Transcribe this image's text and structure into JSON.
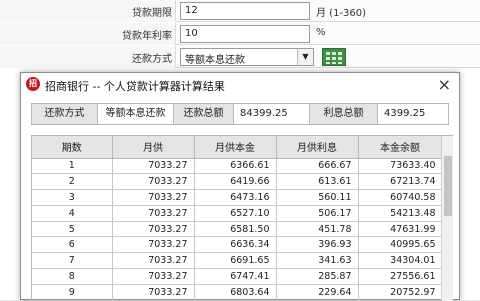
{
  "form": {
    "term_label": "贷款期限",
    "term_value": "12",
    "term_unit": "月 (1-360)",
    "rate_label": "贷款年利率",
    "rate_value": "10",
    "rate_unit": "%",
    "method_label": "还款方式",
    "method_value": "等额本息还款",
    "dropdown_icon": "chevron-down-icon",
    "calc_icon": "calculator-icon"
  },
  "dialog": {
    "title": "招商银行 -- 个人贷款计算器计算结果",
    "logo_text": "招",
    "close_glyph": "×",
    "summary": {
      "method_label": "还款方式",
      "method_value": "等额本息还款",
      "total_label": "还款总额",
      "total_value": "84399.25",
      "interest_label": "利息总额",
      "interest_value": "4399.25"
    },
    "table": {
      "headers": [
        "期数",
        "月供",
        "月供本金",
        "月供利息",
        "本金余额"
      ],
      "rows": [
        [
          "1",
          "7033.27",
          "6366.61",
          "666.67",
          "73633.40"
        ],
        [
          "2",
          "7033.27",
          "6419.66",
          "613.61",
          "67213.74"
        ],
        [
          "3",
          "7033.27",
          "6473.16",
          "560.11",
          "60740.58"
        ],
        [
          "4",
          "7033.27",
          "6527.10",
          "506.17",
          "54213.48"
        ],
        [
          "5",
          "7033.27",
          "6581.50",
          "451.78",
          "47631.99"
        ],
        [
          "6",
          "7033.27",
          "6636.34",
          "396.93",
          "40995.65"
        ],
        [
          "7",
          "7033.27",
          "6691.65",
          "341.63",
          "34304.01"
        ],
        [
          "8",
          "7033.27",
          "6747.41",
          "285.87",
          "27556.61"
        ],
        [
          "9",
          "7033.27",
          "6803.64",
          "229.64",
          "20752.97"
        ]
      ]
    }
  },
  "colors": {
    "brand_red": "#c8151d",
    "calc_green": "#3f8f46",
    "header_gray": "#e4e4e4"
  }
}
